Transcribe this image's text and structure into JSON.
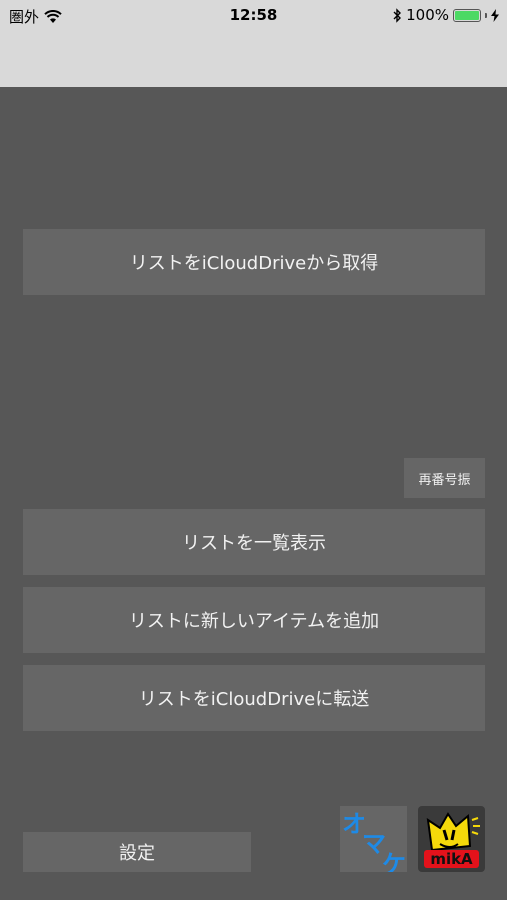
{
  "status_bar": {
    "carrier": "圏外",
    "time": "12:58",
    "battery_percent": "100%",
    "battery_level": 1.0,
    "icons": [
      "wifi-icon",
      "bluetooth-icon",
      "battery-icon",
      "charging-icon"
    ]
  },
  "main": {
    "fetch_button": "リストをiCloudDriveから取得",
    "renumber_button": "再番号振",
    "list_button": "リストを一覧表示",
    "add_button": "リストに新しいアイテムを追加",
    "transfer_button": "リストをiCloudDriveに転送",
    "settings_button": "設定"
  },
  "omake": {
    "chars": [
      "オ",
      "マ",
      "ケ"
    ]
  },
  "mika_logo": {
    "text": "mikA"
  },
  "colors": {
    "background": "#575757",
    "button": "#666666",
    "status_bar": "#d9d9d9",
    "omake_text": "#1e8ae6",
    "mika_yellow": "#f5d90a",
    "mika_red": "#e3121b"
  }
}
